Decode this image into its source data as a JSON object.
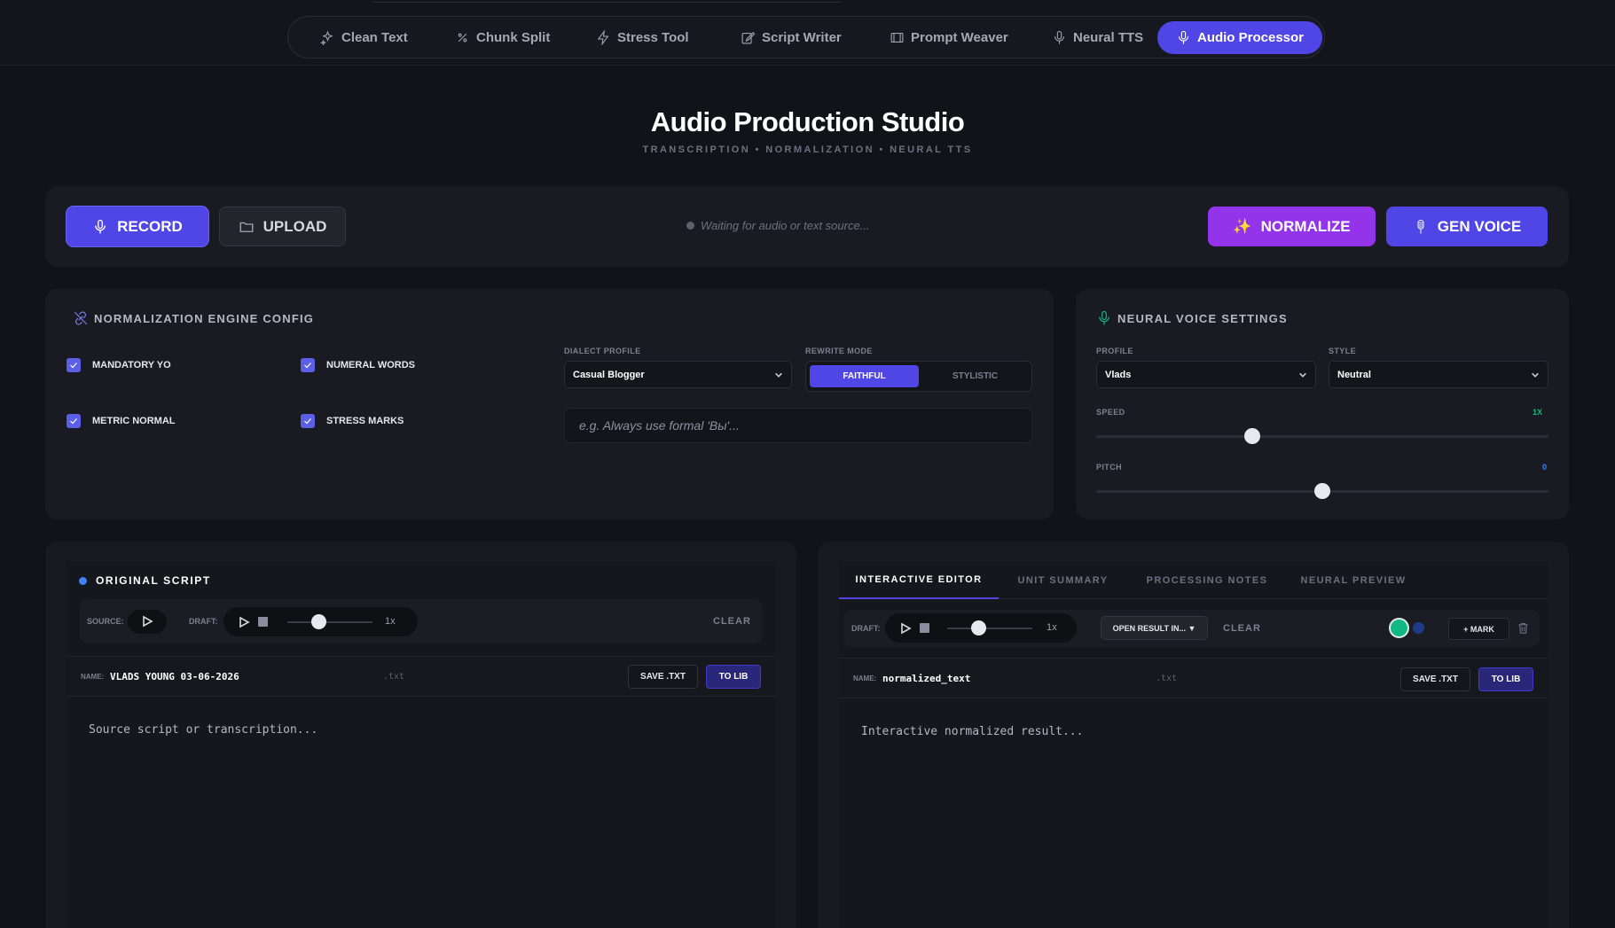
{
  "nav": {
    "tabs": [
      {
        "label": "Clean Text",
        "icon": "sparkles-icon"
      },
      {
        "label": "Chunk Split",
        "icon": "split-icon"
      },
      {
        "label": "Stress Tool",
        "icon": "bolt-icon"
      },
      {
        "label": "Script Writer",
        "icon": "pencil-icon"
      },
      {
        "label": "Prompt Weaver",
        "icon": "film-icon"
      },
      {
        "label": "Neural TTS",
        "icon": "mic-icon"
      },
      {
        "label": "Audio Processor",
        "icon": "mic-icon"
      }
    ],
    "active": "Audio Processor"
  },
  "header": {
    "title": "Audio Production Studio",
    "subtitle": "TRANSCRIPTION • NORMALIZATION • NEURAL TTS"
  },
  "actions": {
    "record": "RECORD",
    "upload": "UPLOAD",
    "status": "Waiting for audio or text source...",
    "normalize": "NORMALIZE",
    "gen_voice": "GEN VOICE"
  },
  "norm_config": {
    "title": "NORMALIZATION ENGINE CONFIG",
    "checkboxes": [
      {
        "label": "MANDATORY YO",
        "checked": true
      },
      {
        "label": "NUMERAL WORDS",
        "checked": true
      },
      {
        "label": "METRIC NORMAL",
        "checked": true
      },
      {
        "label": "STRESS MARKS",
        "checked": true
      }
    ],
    "dialect_label": "DIALECT PROFILE",
    "dialect_value": "Casual Blogger",
    "rewrite_label": "REWRITE MODE",
    "rewrite_options": [
      "FAITHFUL",
      "STYLISTIC"
    ],
    "rewrite_active": "FAITHFUL",
    "instruction_placeholder": "e.g. Always use formal 'Вы'..."
  },
  "voice_settings": {
    "title": "NEURAL VOICE SETTINGS",
    "profile_label": "PROFILE",
    "profile_value": "Vlads",
    "style_label": "STYLE",
    "style_value": "Neutral",
    "speed_label": "SPEED",
    "speed_value": "1X",
    "speed_level": 0.34,
    "pitch_label": "PITCH",
    "pitch_value": "0",
    "pitch_level": 0.5
  },
  "original": {
    "title": "ORIGINAL SCRIPT",
    "source_label": "SOURCE:",
    "draft_label": "DRAFT:",
    "rate": "1x",
    "draft_level": 0.36,
    "clear": "CLEAR",
    "name_label": "NAME:",
    "name_value": "VLADS YOUNG 03-06-2026",
    "ext": ".txt",
    "save": "SAVE .TXT",
    "to_lib": "TO LIB",
    "placeholder": "Source script or transcription..."
  },
  "result": {
    "tabs": [
      "INTERACTIVE EDITOR",
      "UNIT SUMMARY",
      "PROCESSING NOTES",
      "NEURAL PREVIEW"
    ],
    "active_tab": "INTERACTIVE EDITOR",
    "draft_label": "DRAFT:",
    "rate": "1x",
    "draft_level": 0.36,
    "open_result": "OPEN RESULT IN... ▼",
    "clear": "CLEAR",
    "mark": "+ MARK",
    "name_label": "NAME:",
    "name_value": "normalized_text",
    "ext": ".txt",
    "save": "SAVE .TXT",
    "to_lib": "TO LIB",
    "placeholder": "Interactive normalized result..."
  },
  "colors": {
    "accent": "#4f46e5",
    "normalize": "#9333ea",
    "mark_green": "#10b981",
    "mark_blue": "#1e3a8a",
    "speed_value": "#10b981",
    "pitch_value": "#3b82f6"
  }
}
